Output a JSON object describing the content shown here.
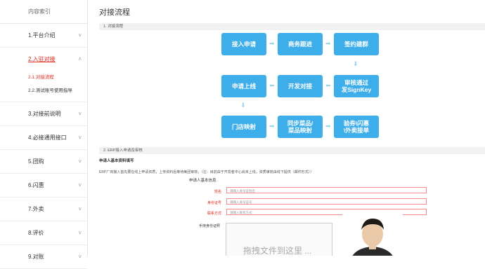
{
  "sidebar": {
    "title": "内容索引",
    "items": [
      {
        "label": "1.平台介绍",
        "chevron": "˅"
      },
      {
        "label": "2.入驻对接",
        "chevron": "˄",
        "active": true,
        "subitems": [
          {
            "label": "2.1.对接流程",
            "active": true
          },
          {
            "label": "2.2.测试账号使用指导"
          }
        ]
      },
      {
        "label": "3.对接前说明",
        "chevron": "˅"
      },
      {
        "label": "4.必接通用接口",
        "chevron": "˅"
      },
      {
        "label": "5.团购",
        "chevron": "˅"
      },
      {
        "label": "6.闪惠",
        "chevron": "˅"
      },
      {
        "label": "7.外卖",
        "chevron": "˅"
      },
      {
        "label": "8.评价",
        "chevron": "˅"
      },
      {
        "label": "9.对账",
        "chevron": "˅"
      }
    ]
  },
  "main": {
    "title": "对接流程",
    "section1": "1. 对接流程",
    "flow": {
      "b1": "接入申请",
      "b2": "商务跟进",
      "b3": "签约建群",
      "b4": "审核通过\n发SignKey",
      "b5": "开发对接",
      "b6": "申请上线",
      "b7": "门店映射",
      "b8": "同步菜品/\n菜品映射",
      "b9": "验券\\闪惠\n\\外卖接单",
      "arrow_right": "➡",
      "arrow_left": "⬅",
      "arrow_down": "⬇"
    },
    "section2": "2. ERP接入申请及审核",
    "form_title": "申请人基本资料填写",
    "description": "ERP厂商接入首先要在线上申请资质，上传资料后等待美团审核，（注：目前由于开发者中心尚未上线，资质审核由线下提供（邮件形式））",
    "form_header": "申请人基本信息",
    "fields": [
      {
        "label": "姓名",
        "placeholder": "请输入身份证姓名"
      },
      {
        "label": "身份证号",
        "placeholder": "请输入身份证号"
      },
      {
        "label": "联系方式",
        "placeholder": "请输入联系方式"
      }
    ],
    "photo_label": "手持身份证照",
    "drop_text": "拖拽文件到这里 ..."
  }
}
